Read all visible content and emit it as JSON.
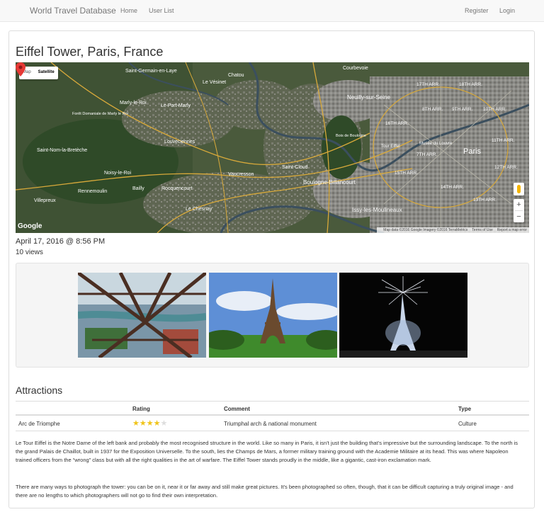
{
  "navbar": {
    "brand": "World Travel Database",
    "links": [
      "Home",
      "User List"
    ],
    "right_links": [
      "Register",
      "Login"
    ]
  },
  "page": {
    "title": "Eiffel Tower, Paris, France",
    "date": "April 17, 2016 @ 8:56 PM",
    "views": "10 views"
  },
  "map": {
    "toggle": [
      "Map",
      "Satellite"
    ],
    "active_toggle": "Satellite",
    "logo": "Google",
    "footer": [
      "Map data ©2016 Google Imagery ©2016 TerraMetrics",
      "Terms of Use",
      "Report a map error"
    ],
    "zoom_in": "+",
    "zoom_out": "−",
    "labels": [
      {
        "text": "Saint-Germain-en-Laye"
      },
      {
        "text": "Chatou"
      },
      {
        "text": "Courbevoie"
      },
      {
        "text": "Le Vésinet"
      },
      {
        "text": "Neuilly-sur-Seine"
      },
      {
        "text": "Marly-le-Roi"
      },
      {
        "text": "Le Port-Marly"
      },
      {
        "text": "Forêt Domaniale de Marly le Roi"
      },
      {
        "text": "Louveciennes"
      },
      {
        "text": "Saint-Nom-la-Bretèche"
      },
      {
        "text": "Noisy-le-Roi"
      },
      {
        "text": "Bailly"
      },
      {
        "text": "Rocquencourt"
      },
      {
        "text": "Rennemoulin"
      },
      {
        "text": "Vaucresson"
      },
      {
        "text": "Saint-Cloud"
      },
      {
        "text": "Boulogne-Billancourt"
      },
      {
        "text": "Issy-les-Moulineaux"
      },
      {
        "text": "Le Chesnay"
      },
      {
        "text": "Villepreux"
      },
      {
        "text": "Paris"
      },
      {
        "text": "Musée du Louvre"
      },
      {
        "text": "Tour Eiffel"
      },
      {
        "text": "17TH ARR."
      },
      {
        "text": "18TH ARR."
      },
      {
        "text": "8TH ARR."
      },
      {
        "text": "9TH ARR."
      },
      {
        "text": "10TH ARR."
      },
      {
        "text": "16TH ARR."
      },
      {
        "text": "7TH ARR."
      },
      {
        "text": "15TH ARR."
      },
      {
        "text": "14TH ARR."
      },
      {
        "text": "13TH ARR."
      },
      {
        "text": "11TH ARR."
      },
      {
        "text": "12TH ARR."
      },
      {
        "text": "Bois de Boulogne"
      }
    ]
  },
  "attractions": {
    "title": "Attractions",
    "headers": [
      "Rating",
      "Comment",
      "Type"
    ],
    "rows": [
      {
        "name": "Arc de Triomphe",
        "rating": 4,
        "max": 5,
        "comment": "Triumphal arch & national monument",
        "type": "Culture"
      }
    ]
  },
  "description": [
    "Le Tour Eiffel is the Notre Dame of the left bank and probably the most recognised structure in the world. Like so many in Paris, it isn’t just the building that’s impressive but the surrounding landscape. To the north is the grand Palais de Chaillot, built in 1937 for the Exposition Universelle. To the south, lies the Champs de Mars, a former military training ground with the Academie Militaire at its head. This was where Napoleon trained officers from the “wrong” class but with all the right qualities in the art of warfare. The Eiffel Tower stands proudly in the middle, like a gigantic, cast-iron exclamation mark.",
    "There are many ways to photograph the tower: you can be on it, near it or far away and still make great pictures. It’s been photographed so often, though, that it can be difficult capturing a truly original image - and there are no lengths to which photographers will not go to find their own interpretation."
  ],
  "colors": {
    "star": "#f0c419",
    "star_empty": "#dddddd"
  }
}
